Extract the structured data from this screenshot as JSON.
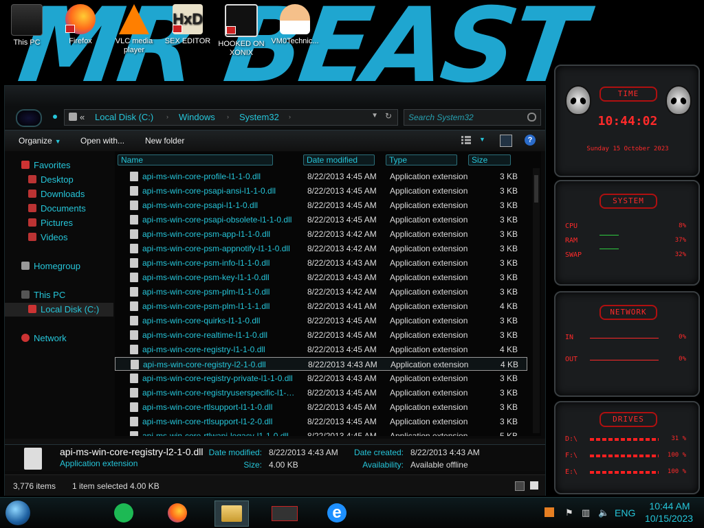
{
  "desktop": {
    "wallpaper_text": "MR BEAST",
    "icons": [
      {
        "label": "This PC"
      },
      {
        "label": "Firefox"
      },
      {
        "label": "VLC media player"
      },
      {
        "label": "SEX EDITOR"
      },
      {
        "label": "HOOKED ON XONIX"
      },
      {
        "label": "VM0Technic..."
      }
    ]
  },
  "explorer": {
    "breadcrumb": {
      "root_chevron": "«",
      "crumbs": [
        "Local Disk (C:)",
        "Windows",
        "System32"
      ]
    },
    "search": {
      "placeholder": "Search System32"
    },
    "toolbar": {
      "organize": "Organize",
      "open_with": "Open with...",
      "new_folder": "New folder"
    },
    "nav": {
      "favorites": "Favorites",
      "desktop": "Desktop",
      "downloads": "Downloads",
      "documents": "Documents",
      "pictures": "Pictures",
      "videos": "Videos",
      "homegroup": "Homegroup",
      "this_pc": "This PC",
      "local_disk": "Local Disk (C:)",
      "network": "Network"
    },
    "columns": {
      "name": "Name",
      "date": "Date modified",
      "type": "Type",
      "size": "Size"
    },
    "files": [
      {
        "name": "api-ms-win-core-profile-l1-1-0.dll",
        "date": "8/22/2013 4:45 AM",
        "type": "Application extension",
        "size": "3 KB"
      },
      {
        "name": "api-ms-win-core-psapi-ansi-l1-1-0.dll",
        "date": "8/22/2013 4:45 AM",
        "type": "Application extension",
        "size": "3 KB"
      },
      {
        "name": "api-ms-win-core-psapi-l1-1-0.dll",
        "date": "8/22/2013 4:45 AM",
        "type": "Application extension",
        "size": "3 KB"
      },
      {
        "name": "api-ms-win-core-psapi-obsolete-l1-1-0.dll",
        "date": "8/22/2013 4:45 AM",
        "type": "Application extension",
        "size": "3 KB"
      },
      {
        "name": "api-ms-win-core-psm-app-l1-1-0.dll",
        "date": "8/22/2013 4:42 AM",
        "type": "Application extension",
        "size": "3 KB"
      },
      {
        "name": "api-ms-win-core-psm-appnotify-l1-1-0.dll",
        "date": "8/22/2013 4:42 AM",
        "type": "Application extension",
        "size": "3 KB"
      },
      {
        "name": "api-ms-win-core-psm-info-l1-1-0.dll",
        "date": "8/22/2013 4:43 AM",
        "type": "Application extension",
        "size": "3 KB"
      },
      {
        "name": "api-ms-win-core-psm-key-l1-1-0.dll",
        "date": "8/22/2013 4:43 AM",
        "type": "Application extension",
        "size": "3 KB"
      },
      {
        "name": "api-ms-win-core-psm-plm-l1-1-0.dll",
        "date": "8/22/2013 4:42 AM",
        "type": "Application extension",
        "size": "3 KB"
      },
      {
        "name": "api-ms-win-core-psm-plm-l1-1-1.dll",
        "date": "8/22/2013 4:41 AM",
        "type": "Application extension",
        "size": "4 KB"
      },
      {
        "name": "api-ms-win-core-quirks-l1-1-0.dll",
        "date": "8/22/2013 4:45 AM",
        "type": "Application extension",
        "size": "3 KB"
      },
      {
        "name": "api-ms-win-core-realtime-l1-1-0.dll",
        "date": "8/22/2013 4:45 AM",
        "type": "Application extension",
        "size": "3 KB"
      },
      {
        "name": "api-ms-win-core-registry-l1-1-0.dll",
        "date": "8/22/2013 4:45 AM",
        "type": "Application extension",
        "size": "4 KB"
      },
      {
        "name": "api-ms-win-core-registry-l2-1-0.dll",
        "date": "8/22/2013 4:43 AM",
        "type": "Application extension",
        "size": "4 KB",
        "selected": true
      },
      {
        "name": "api-ms-win-core-registry-private-l1-1-0.dll",
        "date": "8/22/2013 4:43 AM",
        "type": "Application extension",
        "size": "3 KB"
      },
      {
        "name": "api-ms-win-core-registryuserspecific-l1-1-0....",
        "date": "8/22/2013 4:45 AM",
        "type": "Application extension",
        "size": "3 KB"
      },
      {
        "name": "api-ms-win-core-rtlsupport-l1-1-0.dll",
        "date": "8/22/2013 4:45 AM",
        "type": "Application extension",
        "size": "3 KB"
      },
      {
        "name": "api-ms-win-core-rtlsupport-l1-2-0.dll",
        "date": "8/22/2013 4:45 AM",
        "type": "Application extension",
        "size": "3 KB"
      },
      {
        "name": "api-ms-win-core-rtlwapi-legacy-l1-1-0.dll",
        "date": "8/22/2013 4:45 AM",
        "type": "Application extension",
        "size": "5 KB"
      }
    ],
    "details": {
      "name": "api-ms-win-core-registry-l2-1-0.dll",
      "type": "Application extension",
      "date_modified_label": "Date modified:",
      "date_modified": "8/22/2013 4:43 AM",
      "size_label": "Size:",
      "size": "4.00 KB",
      "date_created_label": "Date created:",
      "date_created": "8/22/2013 4:43 AM",
      "availability_label": "Availability:",
      "availability": "Available offline"
    },
    "status": {
      "count": "3,776 items",
      "selected": "1 item selected  4.00 KB"
    }
  },
  "gadgets": {
    "time": {
      "title": "TIME",
      "clock": "10:44:02",
      "date": "Sunday 15 October 2023"
    },
    "system": {
      "title": "SYSTEM",
      "rows": [
        {
          "label": "CPU",
          "value": "8%"
        },
        {
          "label": "RAM",
          "value": "37%"
        },
        {
          "label": "SWAP",
          "value": "32%"
        }
      ]
    },
    "network": {
      "title": "NETWORK",
      "rows": [
        {
          "label": "IN",
          "value": "0%"
        },
        {
          "label": "OUT",
          "value": "0%"
        }
      ]
    },
    "drives": {
      "title": "DRIVES",
      "rows": [
        {
          "label": "D:\\",
          "value": "31 %"
        },
        {
          "label": "F:\\",
          "value": "100 %"
        },
        {
          "label": "E:\\",
          "value": "100 %"
        }
      ]
    },
    "accent_color": "#ff2a2a"
  },
  "taskbar": {
    "language": "ENG",
    "time": "10:44 AM",
    "date": "10/15/2023"
  },
  "colors": {
    "accent": "#26c6da",
    "background": "#000000"
  }
}
